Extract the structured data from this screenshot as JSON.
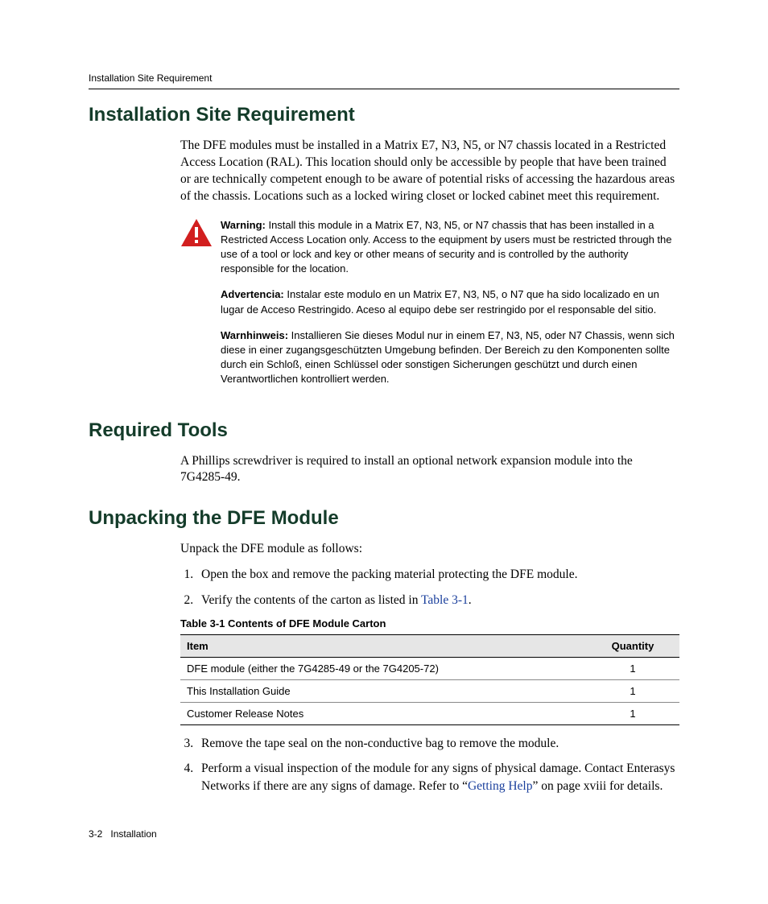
{
  "header": {
    "running": "Installation Site Requirement"
  },
  "sections": {
    "site": {
      "title": "Installation Site Requirement",
      "body": "The DFE modules must be installed in a Matrix E7, N3, N5, or N7 chassis located in a Restricted Access Location (RAL). This location should only be accessible by people that have been trained or are technically competent enough to be aware of potential risks of accessing the hazardous areas of the chassis. Locations such as a locked wiring closet or locked cabinet meet this requirement."
    },
    "tools": {
      "title": "Required Tools",
      "body": "A Phillips screwdriver is required to install an optional network expansion module into the 7G4285-49."
    },
    "unpack": {
      "title": "Unpacking the DFE Module",
      "intro": "Unpack the DFE module as follows:",
      "step1": "Open the box and remove the packing material protecting the DFE module.",
      "step2_pre": "Verify the contents of the carton as listed in ",
      "step2_link": "Table 3-1",
      "step2_post": ".",
      "step3": "Remove the tape seal on the non-conductive bag to remove the module.",
      "step4_pre": "Perform a visual inspection of the module for any signs of physical damage. Contact Enterasys Networks if there are any signs of damage. Refer to “",
      "step4_link": "Getting Help",
      "step4_post": "”  on page xviii for details."
    }
  },
  "warnings": {
    "en_label": "Warning:",
    "en_text": " Install this module in a Matrix E7, N3, N5, or N7 chassis that has been installed in a Restricted Access Location only. Access to the equipment by users must be restricted through the use of a tool or lock and key or other means of security and is controlled by the authority responsible for the location.",
    "es_label": "Advertencia:",
    "es_text": " Instalar este modulo en un Matrix E7, N3, N5, o N7 que ha sido localizado en un lugar de Acceso Restringido. Aceso al equipo debe ser restringido por el responsable del sitio.",
    "de_label": "Warnhinweis:",
    "de_text": " Installieren Sie dieses Modul nur in einem E7, N3, N5, oder N7 Chassis, wenn sich diese in einer zugangsgeschützten Umgebung befinden. Der Bereich zu den Komponenten sollte durch ein Schloß, einen Schlüssel oder sonstigen Sicherungen geschützt und durch einen Verantwortlichen kontrolliert werden."
  },
  "table": {
    "caption": "Table 3-1    Contents of DFE Module Carton",
    "headers": {
      "item": "Item",
      "qty": "Quantity"
    },
    "rows": [
      {
        "item": "DFE module (either the 7G4285-49 or the 7G4205-72)",
        "qty": "1"
      },
      {
        "item": "This Installation Guide",
        "qty": "1"
      },
      {
        "item": "Customer Release Notes",
        "qty": "1"
      }
    ]
  },
  "footer": {
    "page": "3-2",
    "chapter": "Installation"
  }
}
